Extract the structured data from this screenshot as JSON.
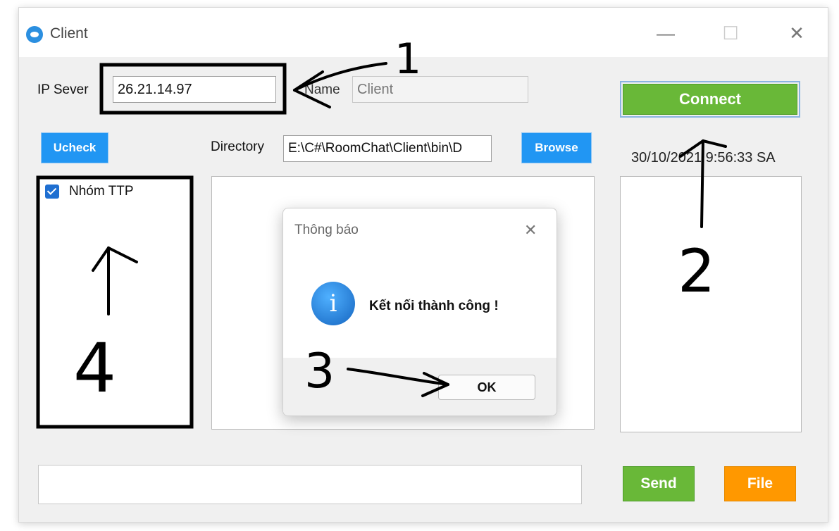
{
  "window": {
    "title": "Client",
    "minimize_glyph": "—",
    "maximize_glyph": "☐",
    "close_glyph": "✕"
  },
  "form": {
    "ip_label": "IP Sever",
    "ip_value": "26.21.14.97",
    "name_label": "Name",
    "name_value": "Client",
    "connect_label": "Connect",
    "uncheck_label": "Ucheck",
    "directory_label": "Directory",
    "directory_value": "E:\\C#\\RoomChat\\Client\\bin\\D",
    "browse_label": "Browse",
    "timestamp": "30/10/2021 9:56:33 SA",
    "send_label": "Send",
    "file_label": "File",
    "message_value": ""
  },
  "groups": [
    {
      "label": "Nhóm TTP",
      "checked": true
    }
  ],
  "dialog": {
    "title": "Thông báo",
    "close_glyph": "✕",
    "icon_glyph": "i",
    "message": "Kết nối thành công !",
    "ok_label": "OK"
  },
  "annotations": {
    "n1": "1",
    "n2": "2",
    "n3": "3",
    "n4": "4"
  },
  "colors": {
    "accent_blue": "#2196f3",
    "connect_green": "#69b838",
    "file_orange": "#ff9800",
    "annotation_ink": "#000000"
  }
}
